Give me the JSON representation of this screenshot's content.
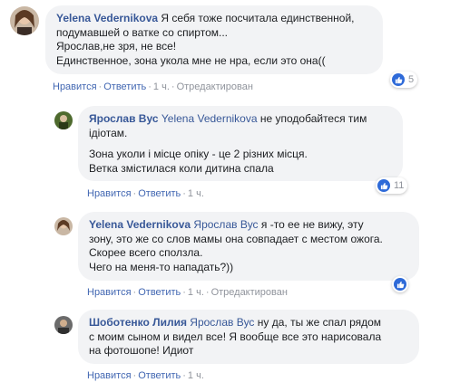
{
  "colors": {
    "link": "#385898",
    "action_link": "#4267b2",
    "meta": "#90949c",
    "bubble_bg": "#f2f3f5",
    "like_blue": "#2e6ad8"
  },
  "comments": [
    {
      "author": "Yelena Vedernikova",
      "mention": "",
      "lines": [
        "Я себя тоже посчитала единственной,",
        "подумавшей о ватке со спиртом...",
        "Ярослав,не зря, не все!",
        "Единственное, зона укола мне не нра, если это она(("
      ],
      "actions": {
        "like": "Нравится",
        "reply": "Ответить",
        "time": "1 ч.",
        "edited": "Отредактирован"
      },
      "reactions": "5"
    },
    {
      "author": "Ярослав Вус",
      "mention": "Yelena Vedernikova",
      "first_line_rest": "не уподобайтеся тим",
      "lines": [
        "ідіотам."
      ],
      "lines2": [
        "Зона уколи і місце опіку - це 2 різних місця.",
        "Ветка змістилася коли дитина спала"
      ],
      "actions": {
        "like": "Нравится",
        "reply": "Ответить",
        "time": "1 ч."
      },
      "reactions": "11"
    },
    {
      "author": "Yelena Vedernikova",
      "mention": "Ярослав Вус",
      "first_line_rest": "я -то ее не вижу, эту",
      "lines": [
        "зону, это же со слов мамы она совпадает с местом ожога.",
        "Скорее всего сползла.",
        "Чего на меня-то нападать?))"
      ],
      "actions": {
        "like": "Нравится",
        "reply": "Ответить",
        "time": "1 ч.",
        "edited": "Отредактирован"
      },
      "reactions": ""
    },
    {
      "author": "Шоботенко Лилия",
      "mention": "Ярослав Вус",
      "first_line_rest": "ну да, ты же спал рядом",
      "lines": [
        "с моим сыном и видел все! Я вообще все это нарисовала",
        "на фотошопе! Идиот"
      ],
      "actions": {
        "like": "Нравится",
        "reply": "Ответить",
        "time": "1 ч."
      },
      "reactions": ""
    }
  ]
}
